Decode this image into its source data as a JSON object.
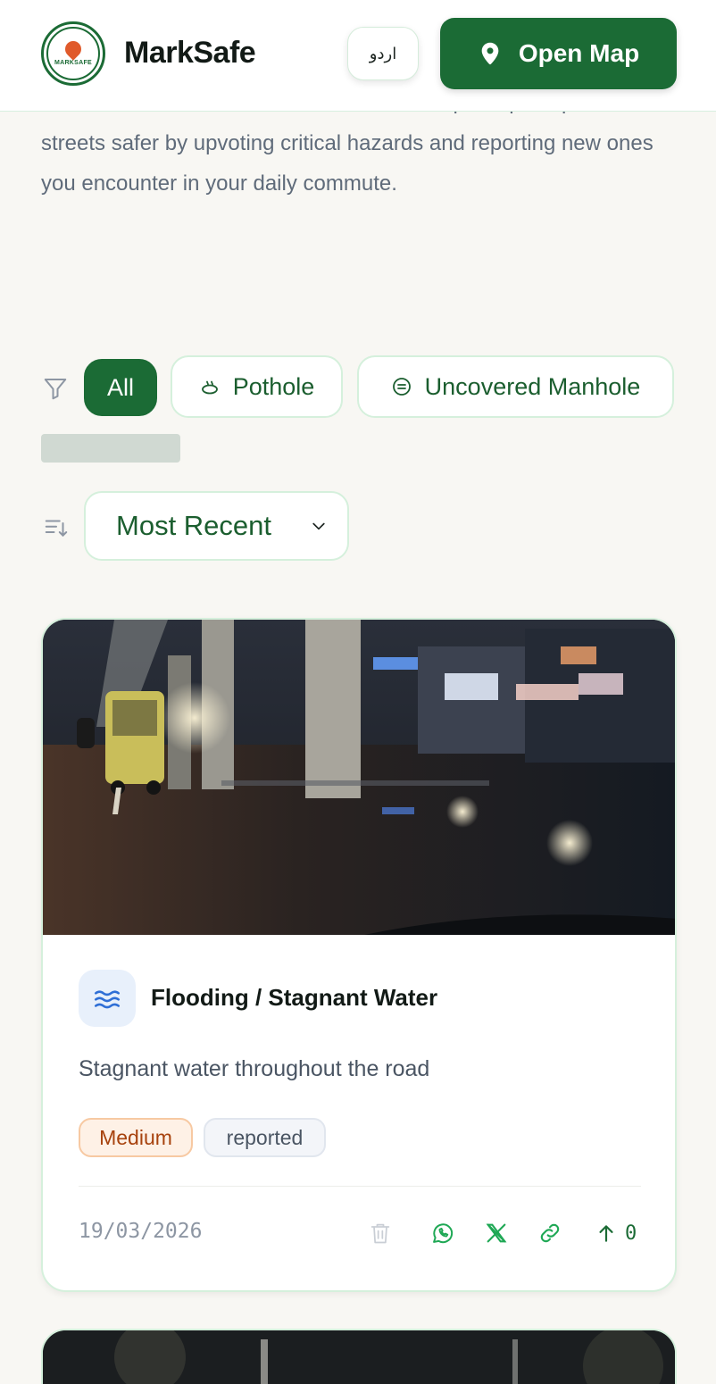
{
  "header": {
    "logo_text": "MARKSAFE",
    "brand": "MarkSafe",
    "lang_label": "اردو",
    "open_map_label": "Open Map"
  },
  "intro": {
    "text": "view its exact location on the interactive map. Help keep Pakistan's streets safer by upvoting critical hazards and reporting new ones you encounter in your daily commute."
  },
  "filters": {
    "chips": [
      {
        "label": "All",
        "active": true
      },
      {
        "label": "Pothole",
        "icon": "pothole-icon"
      },
      {
        "label": "Uncovered Manhole",
        "icon": "manhole-icon"
      }
    ]
  },
  "sort": {
    "selected": "Most Recent"
  },
  "reports": [
    {
      "category": "Flooding / Stagnant Water",
      "category_icon": "water-waves-icon",
      "description": "Stagnant water throughout the road",
      "severity": "Medium",
      "status": "reported",
      "date": "19/03/2026",
      "upvotes": "0"
    }
  ],
  "colors": {
    "brand_green": "#1b6b35",
    "severity_medium": "#a7420d",
    "category_blue": "#2f6fd6"
  }
}
